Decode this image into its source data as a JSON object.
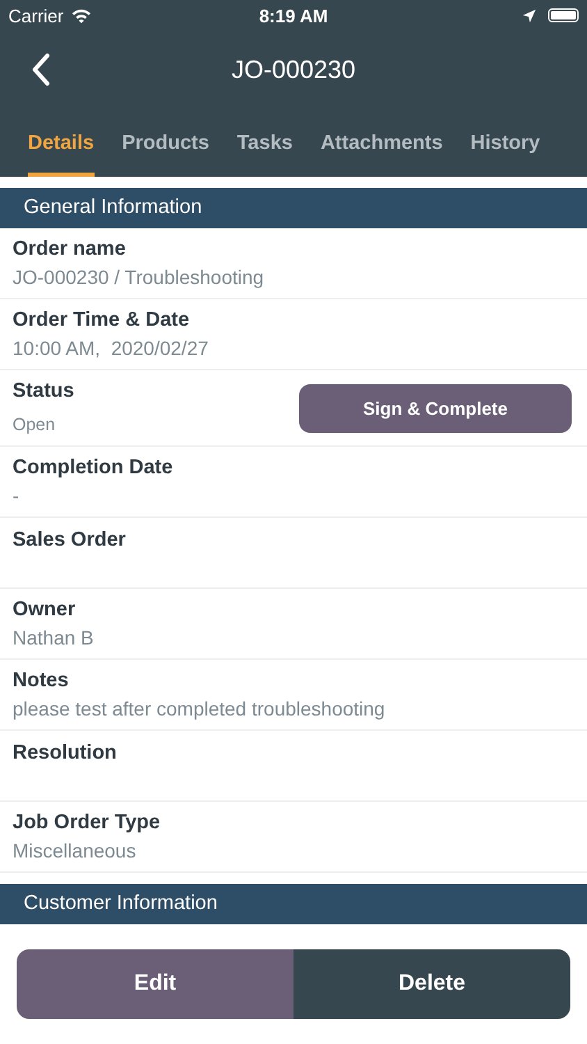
{
  "status_bar": {
    "carrier": "Carrier",
    "time": "8:19 AM"
  },
  "nav": {
    "title": "JO-000230"
  },
  "tabs": [
    {
      "label": "Details",
      "selected": true
    },
    {
      "label": "Products",
      "selected": false
    },
    {
      "label": "Tasks",
      "selected": false
    },
    {
      "label": "Attachments",
      "selected": false
    },
    {
      "label": "History",
      "selected": false
    }
  ],
  "sections": [
    {
      "title": "General Information",
      "fields": [
        {
          "label": "Order name",
          "value": "JO-000230 / Troubleshooting"
        },
        {
          "label": "Order Time & Date",
          "value": "10:00 AM,  2020/02/27"
        },
        {
          "label": "Status",
          "value": "Open",
          "action": "Sign & Complete"
        },
        {
          "label": "Completion Date",
          "value": "-"
        },
        {
          "label": "Sales Order"
        },
        {
          "label": "Owner",
          "value": "Nathan B"
        },
        {
          "label": "Notes",
          "value": "please test after completed troubleshooting"
        },
        {
          "label": "Resolution"
        },
        {
          "label": "Job Order Type",
          "value": "Miscellaneous"
        }
      ]
    },
    {
      "title": "Customer Information"
    }
  ],
  "actions": [
    {
      "label": "Edit",
      "kind": "edit"
    },
    {
      "label": "Delete",
      "kind": "delete"
    }
  ]
}
